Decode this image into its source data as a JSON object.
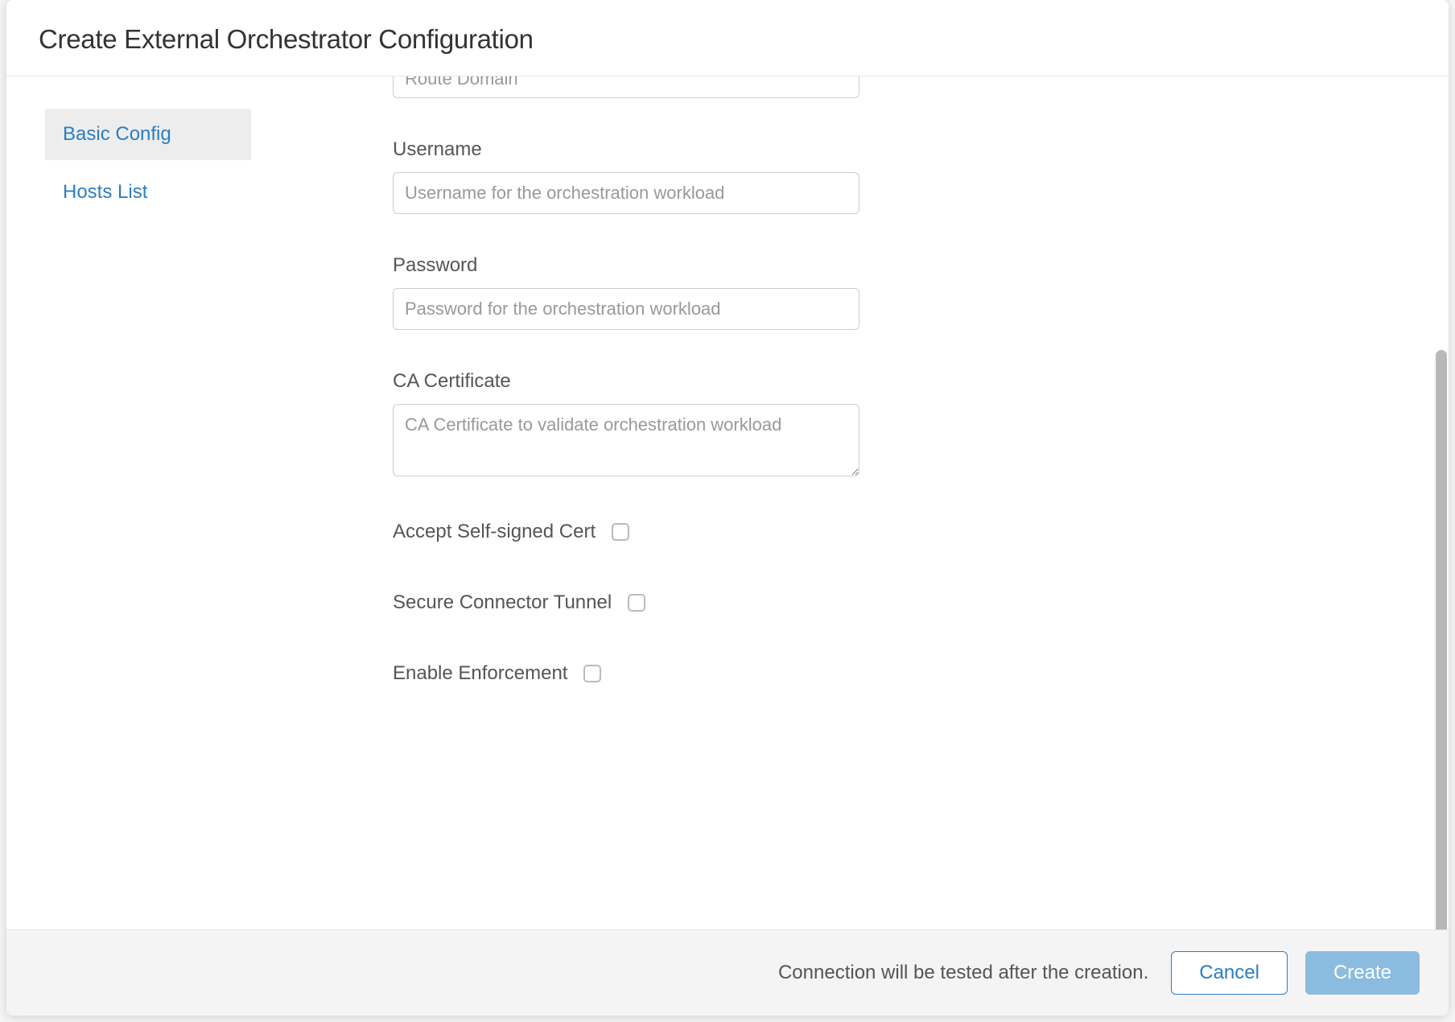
{
  "header": {
    "title": "Create External Orchestrator Configuration"
  },
  "sidebar": {
    "items": [
      {
        "label": "Basic Config",
        "active": true
      },
      {
        "label": "Hosts List",
        "active": false
      }
    ]
  },
  "form": {
    "route_domain": {
      "placeholder": "Route Domain",
      "value": ""
    },
    "username": {
      "label": "Username",
      "placeholder": "Username for the orchestration workload",
      "value": ""
    },
    "password": {
      "label": "Password",
      "placeholder": "Password for the orchestration workload",
      "value": ""
    },
    "ca_certificate": {
      "label": "CA Certificate",
      "placeholder": "CA Certificate to validate orchestration workload",
      "value": ""
    },
    "accept_self_signed": {
      "label": "Accept Self-signed Cert",
      "checked": false
    },
    "secure_connector_tunnel": {
      "label": "Secure Connector Tunnel",
      "checked": false
    },
    "enable_enforcement": {
      "label": "Enable Enforcement",
      "checked": false
    }
  },
  "footer": {
    "note": "Connection will be tested after the creation.",
    "cancel": "Cancel",
    "create": "Create"
  }
}
